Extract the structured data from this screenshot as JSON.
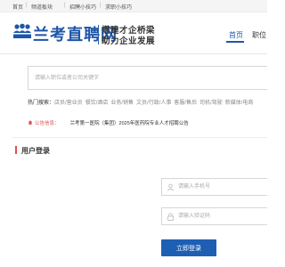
{
  "topbar": {
    "items": [
      "首页",
      "频道板块",
      "招聘小技巧",
      "求职小技巧"
    ]
  },
  "header": {
    "logo_text": "兰考直聘网",
    "slogan_line1": "搭建才企桥梁",
    "slogan_line2": "助力企业发展",
    "nav_home": "首页",
    "nav_next": "职位"
  },
  "search": {
    "placeholder": "请输入职位或者公司关键字"
  },
  "hot": {
    "label": "热门搜索：",
    "keywords": [
      "店员/营业员",
      "餐饮/酒店",
      "业务/销售",
      "文员/行政/人事",
      "客服/售后",
      "司机/驾驶",
      "新媒体/电商"
    ]
  },
  "notice": {
    "label": "公告信息：",
    "text": "兰考第一医院（集团）2025年医药院专业人才招聘公告"
  },
  "login": {
    "title": "用户登录",
    "phone_placeholder": "请输入手机号",
    "code_placeholder": "请输入验证码",
    "button_label": "立即登录"
  },
  "colors": {
    "brand": "#1e56a8",
    "accent_red": "#d9534f",
    "button": "#1e5fb4"
  },
  "icons": {
    "logo": "people-group-icon",
    "notice": "bell-icon",
    "phone_field": "user-icon",
    "code_field": "lock-icon"
  }
}
